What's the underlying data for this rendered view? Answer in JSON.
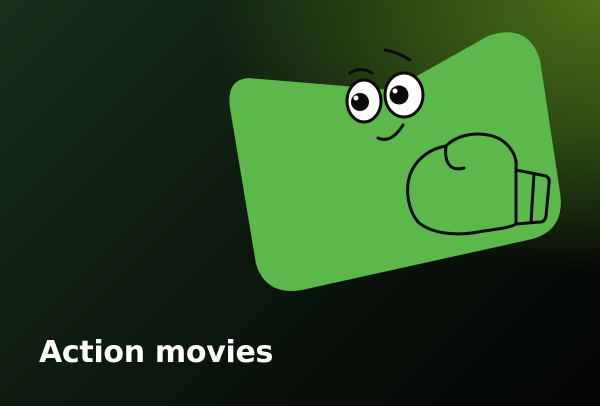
{
  "category": {
    "title": "Action movies"
  },
  "illustration": {
    "icon": "boxing-glove-mascot",
    "body_color": "#5cb84a",
    "outline_color": "#0a0a0a"
  }
}
